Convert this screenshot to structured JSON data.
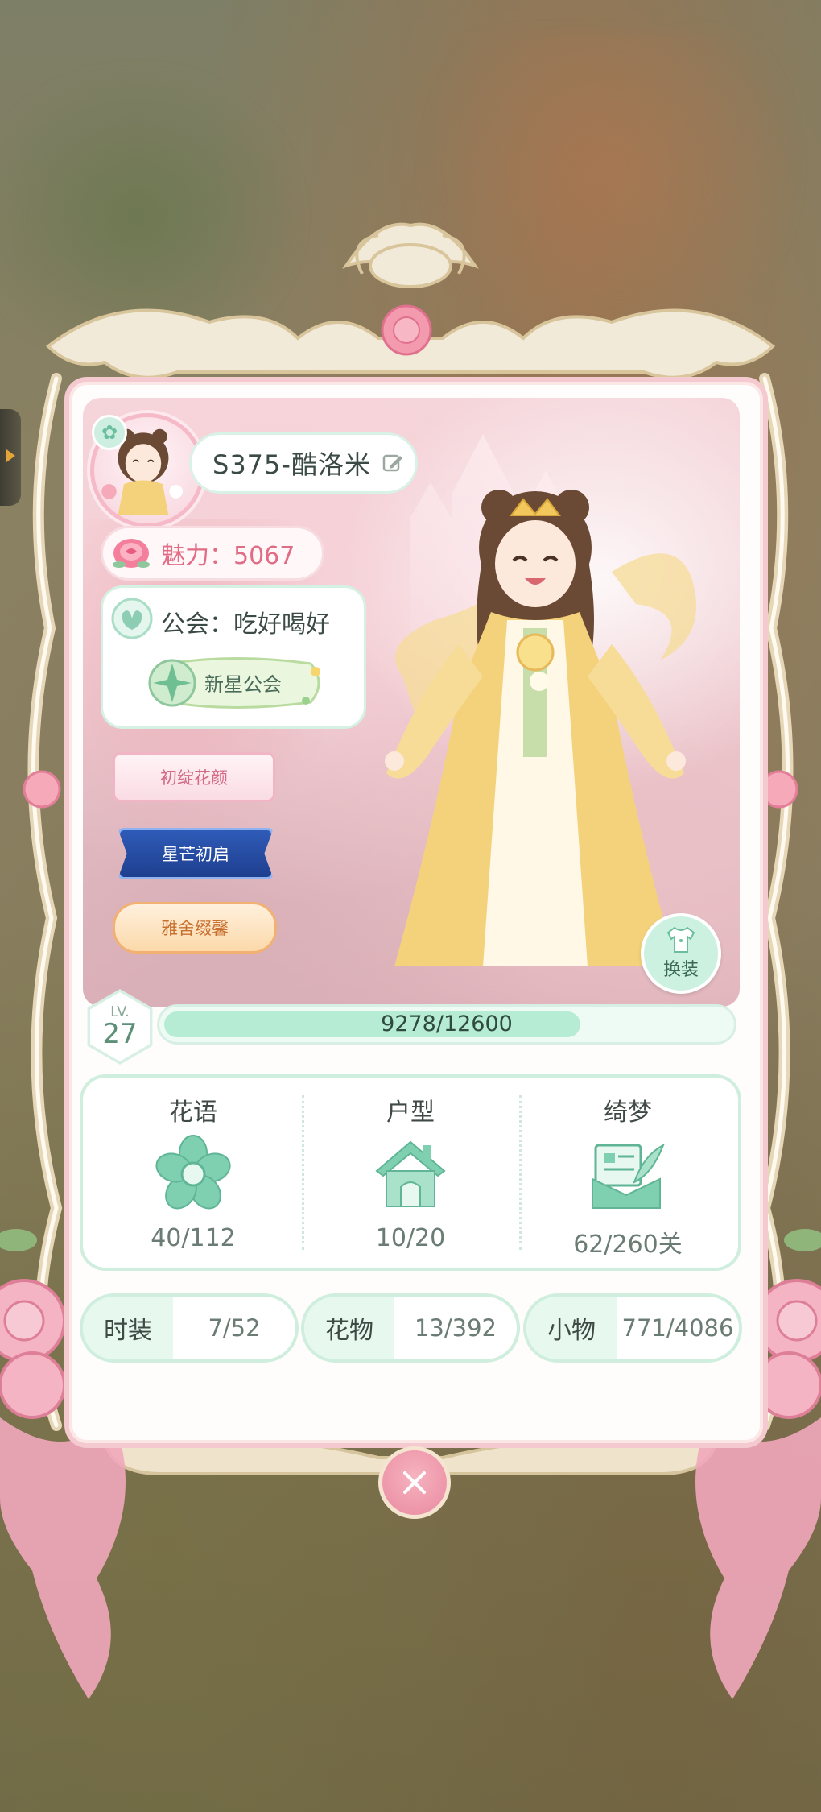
{
  "profile": {
    "name": "S375-酷洛米",
    "charm_label": "魅力：5067",
    "guild_label": "公会：吃好喝好",
    "guild_badge": "新星公会"
  },
  "titles": [
    "初绽花颜",
    "星芒初启",
    "雅舍缀馨"
  ],
  "outfit_button": "换装",
  "level": {
    "label": "LV.",
    "value": "27",
    "xp_text": "9278/12600",
    "xp_fraction": 0.736
  },
  "stats": [
    {
      "title": "花语",
      "value": "40/112",
      "icon": "flower-icon"
    },
    {
      "title": "户型",
      "value": "10/20",
      "icon": "house-icon"
    },
    {
      "title": "绮梦",
      "value": "62/260关",
      "icon": "quill-letter-icon"
    }
  ],
  "collections": [
    {
      "label": "时装",
      "value": "7/52"
    },
    {
      "label": "花物",
      "value": "13/392"
    },
    {
      "label": "小物",
      "value": "771/4086"
    }
  ],
  "colors": {
    "mint": "#cfeede",
    "pink_border": "#f4c9cf",
    "charm_text": "#e16c86",
    "badge_blue": "#1e3f8f"
  }
}
